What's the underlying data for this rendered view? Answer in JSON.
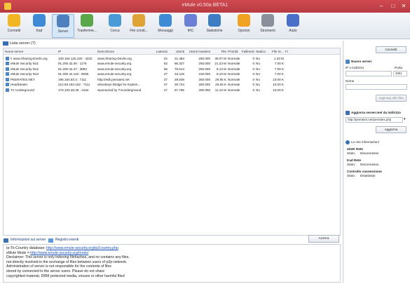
{
  "window": {
    "title": "eMule v0.50a BETA1",
    "minimize_glyph": "–",
    "maximize_glyph": "□",
    "close_glyph": "✕"
  },
  "toolbar": {
    "buttons": [
      {
        "label": "Connetti",
        "icon": "connect-icon",
        "color": "#f3b623"
      },
      {
        "label": "Kad",
        "icon": "kad-icon",
        "color": "#3f8ad6"
      },
      {
        "label": "Server",
        "icon": "server-icon",
        "color": "#4f7fbf"
      },
      {
        "label": "Trasferime...",
        "icon": "transfer-icon",
        "color": "#5aa84a"
      },
      {
        "label": "Cerca",
        "icon": "search-icon",
        "color": "#4a9ad8"
      },
      {
        "label": "File condi...",
        "icon": "shared-files-icon",
        "color": "#e0a336"
      },
      {
        "label": "Messaggi",
        "icon": "messages-icon",
        "color": "#3f8ad6"
      },
      {
        "label": "IRC",
        "icon": "irc-icon",
        "color": "#6a7fd6"
      },
      {
        "label": "Statistiche",
        "icon": "statistics-icon",
        "color": "#3d7dc4"
      },
      {
        "label": "Opzioni",
        "icon": "options-icon",
        "color": "#f0a323"
      },
      {
        "label": "Strumenti",
        "icon": "tools-icon",
        "color": "#8a8f99"
      },
      {
        "label": "Aiuto",
        "icon": "help-icon",
        "color": "#4a6fc8"
      }
    ],
    "active_index": 2
  },
  "server_list": {
    "header": "Lista server (7)",
    "columns": [
      "Nome server",
      "IP",
      "Descrizione",
      "Latenza",
      "Utenti",
      "Utenti massimi",
      "File",
      "Priorità",
      "Fallimenti",
      "Statico",
      "File sc...",
      "Fi"
    ],
    "rows": [
      [
        "!! www.Sharing-Devils.org",
        "109.164.125.220 : 4232",
        "www.Sharing-Devils.org",
        "22",
        "21.484",
        "250.000",
        "38.07 M",
        "Normale",
        "0",
        "No",
        "1.33 M",
        ""
      ],
      [
        "eMule Security No1",
        "91.200.42.46 : 1176",
        "www.emule-security.org",
        "62",
        "86.327",
        "250.000",
        "21.23 M",
        "Normale",
        "0",
        "No",
        "7.00 K",
        ""
      ],
      [
        "eMule Security No2",
        "91.200.42.47 : 3883",
        "www.emule-security.org",
        "56",
        "78.514",
        "250.000",
        "8.13 M",
        "Normale",
        "0",
        "No",
        "7.00 K",
        ""
      ],
      [
        "eMule Security No3",
        "91.200.42.119 : 9939",
        "www.emule-security.org",
        "47",
        "54.119",
        "150.000",
        "8.19 M",
        "Normale",
        "0",
        "No",
        "7.00 K",
        ""
      ],
      [
        "PEERATES.NET",
        "195.154.83.3 : 7111",
        "http://edk.peerates.net",
        "47",
        "28.649",
        "250.000",
        "26.95 K",
        "Normale",
        "0",
        "No",
        "10.00 K",
        ""
      ],
      [
        "Heartbeater",
        "212.83.184.152 : 7111",
        "eDonkeys Bridge for Kadem...",
        "47",
        "26.724",
        "250.000",
        "26.56 K",
        "Normale",
        "0",
        "No",
        "10.00 K",
        ""
      ],
      [
        "TV Underground",
        "176.103.48.36 : 4184",
        "Sponsored by TVUnderground",
        "47",
        "57.795",
        "300.000",
        "11.10 M",
        "Normale",
        "0",
        "No",
        "10.00 K",
        ""
      ]
    ]
  },
  "right_panel": {
    "connect_button": "Connetti",
    "new_server_title": "Nuovo server",
    "ip_address_label": "IP o indirizzo",
    "port_label": "Porta",
    "port_value": "4661",
    "name_label": "Nome",
    "add_to_list_button": "Aggiungi alla lista",
    "update_met_title": "Aggiorna server.met da indirizzo",
    "update_met_url": "http://peerates.net/peerates.php",
    "update_button": "Aggiorna",
    "my_info_title": "Le mie informazioni",
    "emule_network_title": "eD2K Rete",
    "emule_status_label": "Stato:",
    "emule_status_value": "Disconnesso",
    "kad_network_title": "Kad Rete",
    "kad_status_label": "Stato:",
    "kad_status_value": "Disconnesso",
    "webservices_title": "Controllo connessione",
    "webservices_status_label": "Stato:",
    "webservices_status_value": "Disattivato"
  },
  "bottom": {
    "tab_server_info": "Informazioni sul server",
    "tab_log": "Registro eventi",
    "reset_button": "Azzera",
    "log_lines": [
      {
        "prefix": "Ip-To-Country database: ",
        "link": "http://www.emule-security.org/ip2country.php"
      },
      {
        "prefix": "eMule Mods = ",
        "link": "http://www.emule-security.org/mods/"
      },
      {
        "prefix": "Disclaimer: This server is only indexing filehashes, and no contains any files,",
        "link": ""
      },
      {
        "prefix": "not directly involved in the exchange of files between users of p2p-network.",
        "link": ""
      },
      {
        "prefix": "Administration of server is not responsible for the contents of files",
        "link": ""
      },
      {
        "prefix": "stored by connected to the server users. Please do not share",
        "link": ""
      },
      {
        "prefix": "copyrighted material, DRM protected media, viruses or other harmful files!",
        "link": ""
      }
    ]
  }
}
